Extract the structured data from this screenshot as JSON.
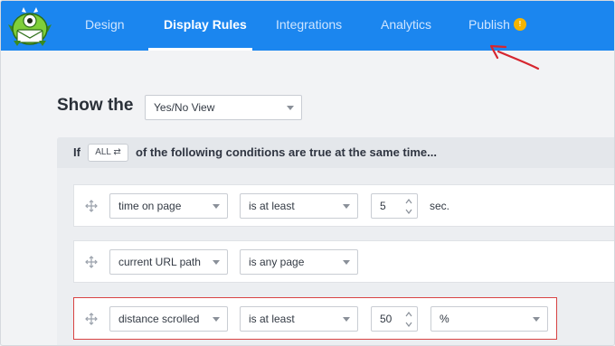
{
  "nav": {
    "tabs": [
      "Design",
      "Display Rules",
      "Integrations",
      "Analytics",
      "Publish"
    ],
    "active": "Display Rules",
    "publish_badge": "!"
  },
  "show": {
    "label": "Show the",
    "view_select": "Yes/No View"
  },
  "conditions": {
    "if_label": "If",
    "all_toggle": "ALL ⇄",
    "text": "of the following conditions are true at the same time..."
  },
  "rules": [
    {
      "field": "time on page",
      "operator": "is at least",
      "value": "5",
      "unit": "sec."
    },
    {
      "field": "current URL path",
      "operator": "is any page"
    },
    {
      "field": "distance scrolled",
      "operator": "is at least",
      "value": "50",
      "unit": "%"
    }
  ],
  "colors": {
    "topbar": "#1b86ef",
    "badge": "#f5b400",
    "highlight": "#d84343",
    "arrow": "#d6262f"
  }
}
